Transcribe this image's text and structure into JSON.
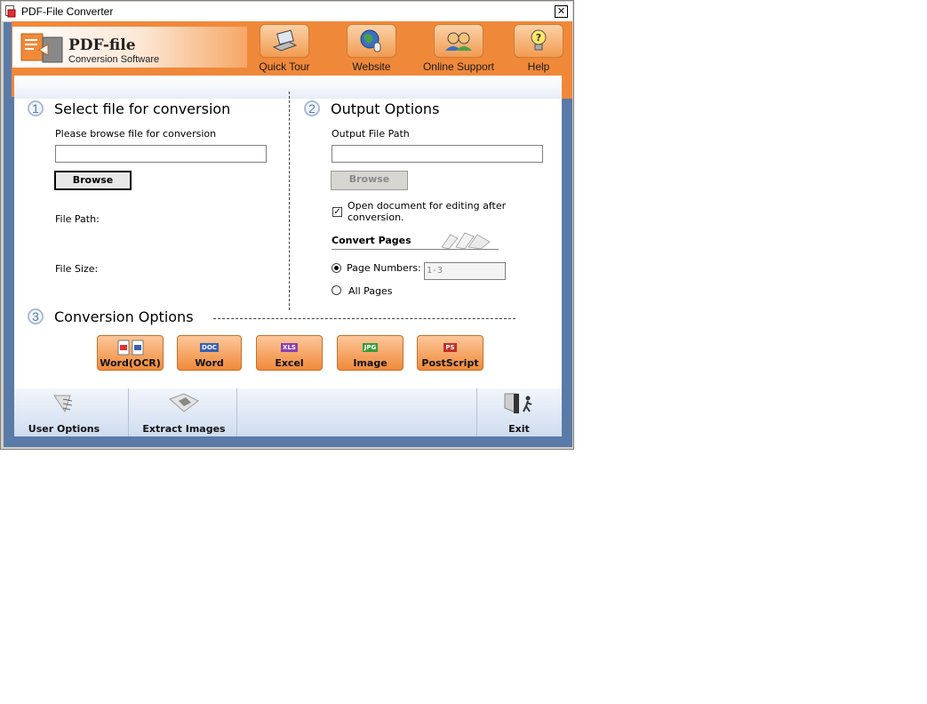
{
  "window": {
    "title": "PDF-File Converter",
    "close_label": "✕"
  },
  "logo": {
    "title": "PDF-file",
    "subtitle": "Conversion Software"
  },
  "toolbar": {
    "quick_tour": "Quick Tour",
    "website": "Website",
    "online_support": "Online Support",
    "help": "Help"
  },
  "section1": {
    "number": "1",
    "title": "Select file for conversion",
    "browse_prompt": "Please browse file for conversion",
    "input_value": "",
    "browse_label": "Browse",
    "file_path_label": "File Path:",
    "file_size_label": "File Size:"
  },
  "section2": {
    "number": "2",
    "title": "Output Options",
    "output_path_label": "Output File Path",
    "input_value": "",
    "browse_label": "Browse",
    "open_doc_checked": true,
    "open_doc_line1": "Open document for editing after",
    "open_doc_line2": "conversion.",
    "convert_pages_label": "Convert Pages",
    "page_numbers_label": "Page Numbers:",
    "page_numbers_value": "1-3",
    "all_pages_label": "All Pages",
    "selected_option": "page_numbers"
  },
  "section3": {
    "number": "3",
    "title": "Conversion Options",
    "buttons": [
      {
        "label": "Word(OCR)",
        "badge": ""
      },
      {
        "label": "Word",
        "badge": "DOC"
      },
      {
        "label": "Excel",
        "badge": "XLS"
      },
      {
        "label": "Image",
        "badge": "JPG"
      },
      {
        "label": "PostScript",
        "badge": "PS"
      }
    ]
  },
  "footer": {
    "user_options": "User Options",
    "extract_images": "Extract Images",
    "exit": "Exit"
  },
  "colors": {
    "accent_orange": "#f0883a",
    "frame_blue": "#5a7ba8",
    "number_blue": "#4f78b6"
  }
}
